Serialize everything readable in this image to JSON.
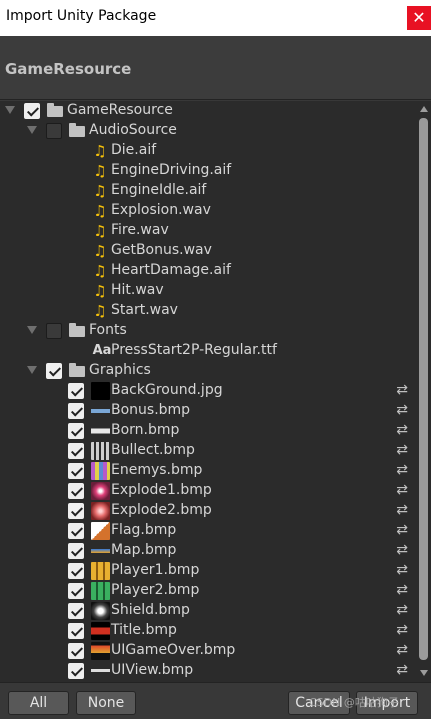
{
  "window": {
    "title": "Import Unity Package",
    "close_glyph": "✕"
  },
  "header": {
    "title": "GameResource"
  },
  "tree": {
    "root": {
      "label": "GameResource",
      "checked": true
    },
    "audio_folder": {
      "label": "AudioSource",
      "checked": false
    },
    "audio_files": [
      "Die.aif",
      "EngineDriving.aif",
      "EngineIdle.aif",
      "Explosion.wav",
      "Fire.wav",
      "GetBonus.wav",
      "HeartDamage.aif",
      "Hit.wav",
      "Start.wav"
    ],
    "fonts_folder": {
      "label": "Fonts",
      "checked": false
    },
    "font_files": [
      {
        "label": "PressStart2P-Regular.ttf",
        "icon_text": "Aa"
      }
    ],
    "graphics_folder": {
      "label": "Graphics",
      "checked": true
    },
    "graphics_files": [
      {
        "label": "BackGround.jpg",
        "checked": true
      },
      {
        "label": "Bonus.bmp",
        "checked": true
      },
      {
        "label": "Born.bmp",
        "checked": true
      },
      {
        "label": "Bullect.bmp",
        "checked": true
      },
      {
        "label": "Enemys.bmp",
        "checked": true
      },
      {
        "label": "Explode1.bmp",
        "checked": true
      },
      {
        "label": "Explode2.bmp",
        "checked": true
      },
      {
        "label": "Flag.bmp",
        "checked": true
      },
      {
        "label": "Map.bmp",
        "checked": true
      },
      {
        "label": "Player1.bmp",
        "checked": true
      },
      {
        "label": "Player2.bmp",
        "checked": true
      },
      {
        "label": "Shield.bmp",
        "checked": true
      },
      {
        "label": "Title.bmp",
        "checked": true
      },
      {
        "label": "UIGameOver.bmp",
        "checked": true
      },
      {
        "label": "UIView.bmp",
        "checked": true
      }
    ],
    "reimport_glyph": "⇄"
  },
  "footer": {
    "all_label": "All",
    "none_label": "None",
    "cancel_label": "Cancel",
    "import_label": "Import"
  },
  "watermark": "CSDN @咕咕狗子",
  "colors": {
    "background": "#383838",
    "tree_bg": "#2b2b2b",
    "audio_icon": "#f6c10a",
    "close_button": "#e81123"
  }
}
